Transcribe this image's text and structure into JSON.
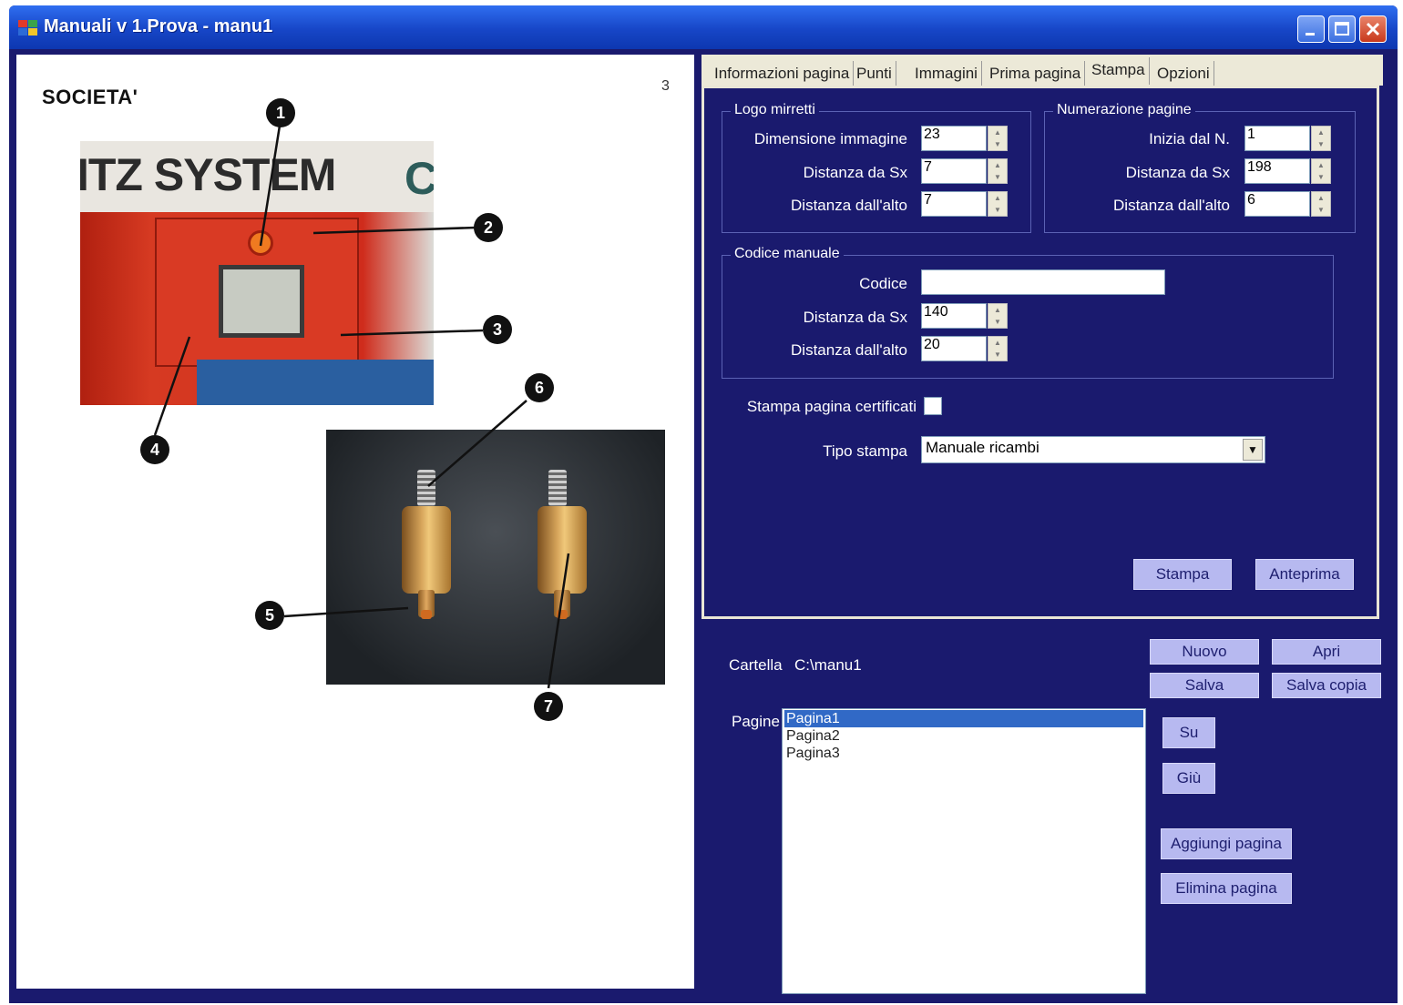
{
  "window": {
    "title": "Manuali v 1.Prova - manu1"
  },
  "preview": {
    "company": "SOCIETA'",
    "page_number": "3",
    "photo1_text": "ITZ SYSTEM",
    "photo1_text_c": "C",
    "callouts": [
      "1",
      "2",
      "3",
      "4",
      "5",
      "6",
      "7"
    ]
  },
  "tabs": [
    {
      "label": "Informazioni pagina"
    },
    {
      "label": "Punti"
    },
    {
      "label": "Immagini"
    },
    {
      "label": "Prima pagina"
    },
    {
      "label": "Stampa",
      "active": true
    },
    {
      "label": "Opzioni"
    }
  ],
  "stampa": {
    "logo_group": {
      "title": "Logo mirretti",
      "dimensione_label": "Dimensione immagine",
      "dimensione_value": "23",
      "distanza_sx_label": "Distanza da Sx",
      "distanza_sx_value": "7",
      "distanza_alto_label": "Distanza dall'alto",
      "distanza_alto_value": "7"
    },
    "numerazione_group": {
      "title": "Numerazione pagine",
      "inizia_label": "Inizia dal N.",
      "inizia_value": "1",
      "distanza_sx_label": "Distanza da Sx",
      "distanza_sx_value": "198",
      "distanza_alto_label": "Distanza dall'alto",
      "distanza_alto_value": "6"
    },
    "codice_group": {
      "title": "Codice manuale",
      "codice_label": "Codice",
      "codice_value": "",
      "distanza_sx_label": "Distanza da Sx",
      "distanza_sx_value": "140",
      "distanza_alto_label": "Distanza dall'alto",
      "distanza_alto_value": "20"
    },
    "certificati_label": "Stampa pagina certificati",
    "certificati_checked": false,
    "tipo_stampa_label": "Tipo stampa",
    "tipo_stampa_value": "Manuale ricambi",
    "stampa_button": "Stampa",
    "anteprima_button": "Anteprima"
  },
  "project": {
    "cartella_label": "Cartella",
    "cartella_value": "C:\\manu1",
    "nuovo_button": "Nuovo",
    "apri_button": "Apri",
    "salva_button": "Salva",
    "salva_copia_button": "Salva copia",
    "pagine_label": "Pagine",
    "pages": [
      "Pagina1",
      "Pagina2",
      "Pagina3"
    ],
    "selected_page": "Pagina1",
    "su_button": "Su",
    "giu_button": "Giù",
    "aggiungi_button": "Aggiungi pagina",
    "elimina_button": "Elimina pagina"
  },
  "colors": {
    "panel_bg": "#1a1a6e",
    "button_bg": "#b7b9f0",
    "titlebar": "#1746c7",
    "selection": "#3169c6"
  }
}
